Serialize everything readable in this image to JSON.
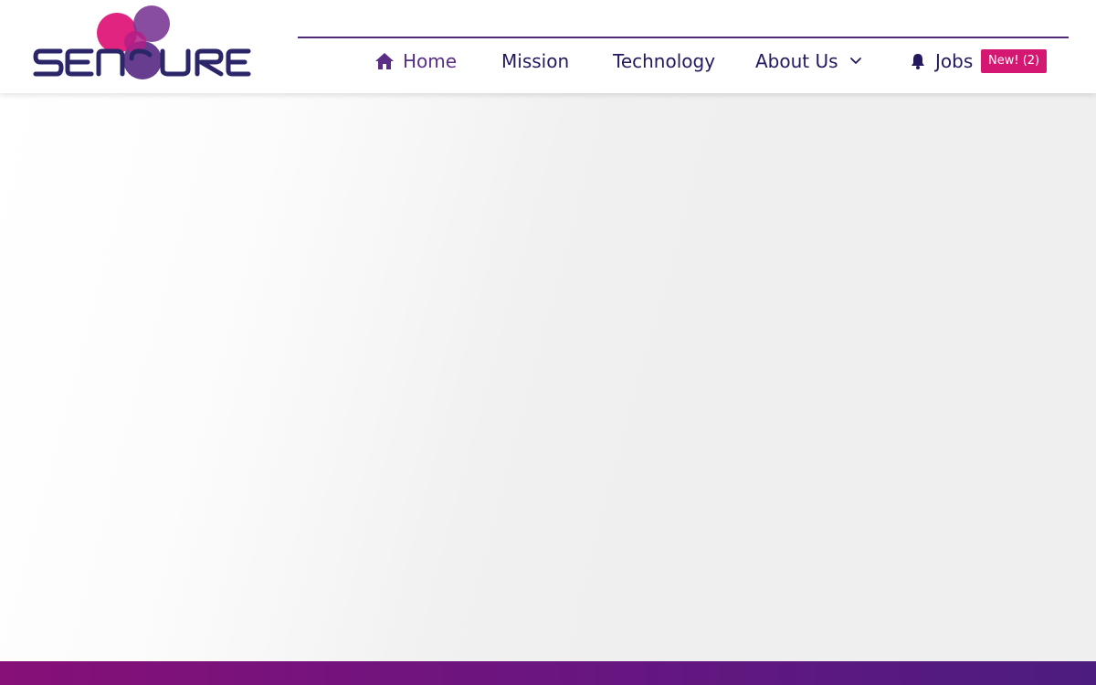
{
  "brand": {
    "logo_text": "SENCURE",
    "colors": {
      "pink": "#d41872",
      "purple": "#6a2d86",
      "navy": "#22195e"
    }
  },
  "nav": {
    "items": [
      {
        "label": "Home",
        "icon": "home-icon",
        "active": true
      },
      {
        "label": "Mission"
      },
      {
        "label": "Technology"
      },
      {
        "label": "About Us",
        "icon": "chevron-down-icon"
      },
      {
        "label": "Jobs",
        "icon": "bell-icon"
      }
    ],
    "jobs_badge": "New! (2)"
  }
}
